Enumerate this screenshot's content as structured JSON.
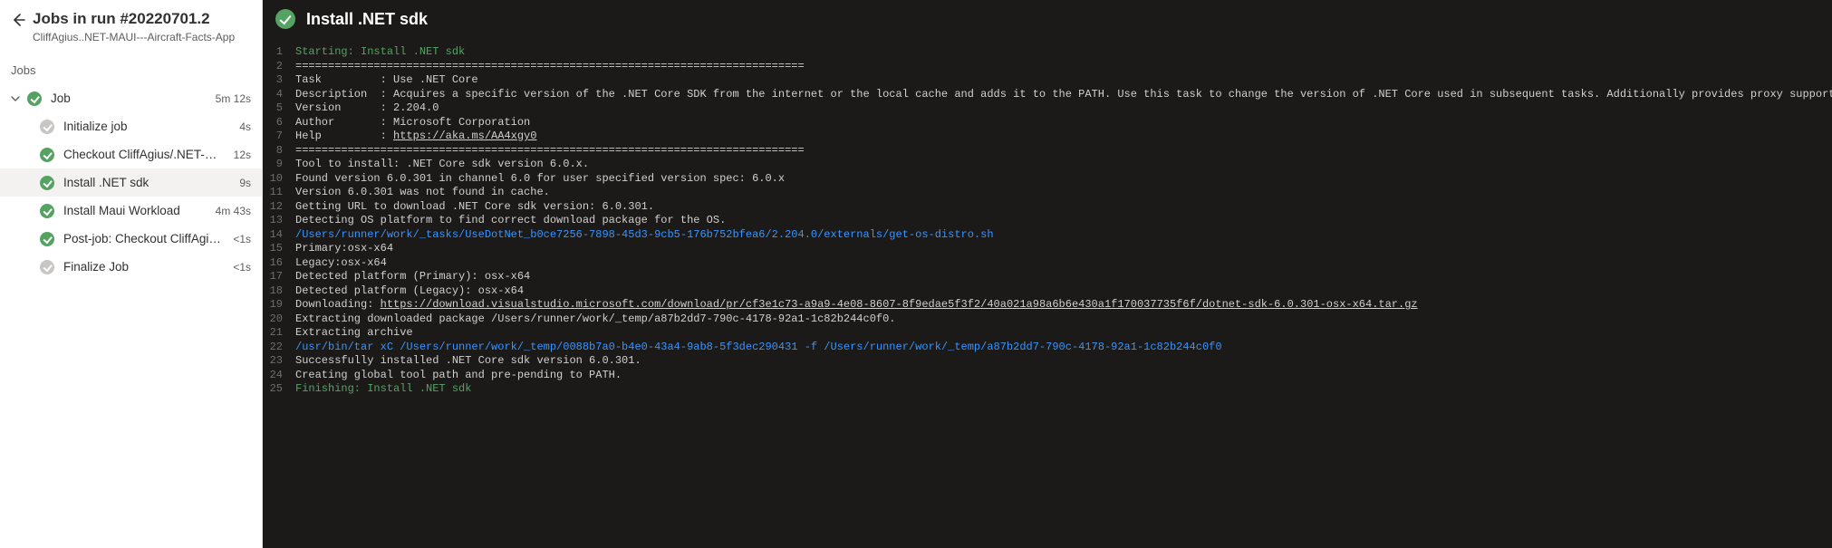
{
  "header": {
    "title": "Jobs in run #20220701.2",
    "subtitle": "CliffAgius..NET-MAUI---Aircraft-Facts-App"
  },
  "section_label": "Jobs",
  "job": {
    "name": "Job",
    "duration": "5m 12s"
  },
  "steps": [
    {
      "icon": "skipped",
      "name": "Initialize job",
      "duration": "4s",
      "selected": false
    },
    {
      "icon": "success",
      "name": "Checkout CliffAgius/.NET-MAUI-...",
      "duration": "12s",
      "selected": false
    },
    {
      "icon": "success",
      "name": "Install .NET sdk",
      "duration": "9s",
      "selected": true
    },
    {
      "icon": "success",
      "name": "Install Maui Workload",
      "duration": "4m 43s",
      "selected": false
    },
    {
      "icon": "success",
      "name": "Post-job: Checkout CliffAgius/.N...",
      "duration": "<1s",
      "selected": false
    },
    {
      "icon": "skipped",
      "name": "Finalize Job",
      "duration": "<1s",
      "selected": false
    }
  ],
  "log": {
    "title": "Install .NET sdk",
    "lines": [
      {
        "n": 1,
        "cls": "c-green",
        "text": "Starting: Install .NET sdk"
      },
      {
        "n": 2,
        "text": "=============================================================================="
      },
      {
        "n": 3,
        "text": "Task         : Use .NET Core"
      },
      {
        "n": 4,
        "text": "Description  : Acquires a specific version of the .NET Core SDK from the internet or the local cache and adds it to the PATH. Use this task to change the version of .NET Core used in subsequent tasks. Additionally provides proxy support."
      },
      {
        "n": 5,
        "text": "Version      : 2.204.0"
      },
      {
        "n": 6,
        "text": "Author       : Microsoft Corporation"
      },
      {
        "n": 7,
        "pre": "Help         : ",
        "link": "https://aka.ms/AA4xgy0"
      },
      {
        "n": 8,
        "text": "=============================================================================="
      },
      {
        "n": 9,
        "text": "Tool to install: .NET Core sdk version 6.0.x."
      },
      {
        "n": 10,
        "text": "Found version 6.0.301 in channel 6.0 for user specified version spec: 6.0.x"
      },
      {
        "n": 11,
        "text": "Version 6.0.301 was not found in cache."
      },
      {
        "n": 12,
        "text": "Getting URL to download .NET Core sdk version: 6.0.301."
      },
      {
        "n": 13,
        "text": "Detecting OS platform to find correct download package for the OS."
      },
      {
        "n": 14,
        "cls": "c-cyan",
        "text": "/Users/runner/work/_tasks/UseDotNet_b0ce7256-7898-45d3-9cb5-176b752bfea6/2.204.0/externals/get-os-distro.sh"
      },
      {
        "n": 15,
        "text": "Primary:osx-x64"
      },
      {
        "n": 16,
        "text": "Legacy:osx-x64"
      },
      {
        "n": 17,
        "text": "Detected platform (Primary): osx-x64"
      },
      {
        "n": 18,
        "text": "Detected platform (Legacy): osx-x64"
      },
      {
        "n": 19,
        "pre": "Downloading: ",
        "link": "https://download.visualstudio.microsoft.com/download/pr/cf3e1c73-a9a9-4e08-8607-8f9edae5f3f2/40a021a98a6b6e430a1f170037735f6f/dotnet-sdk-6.0.301-osx-x64.tar.gz"
      },
      {
        "n": 20,
        "text": "Extracting downloaded package /Users/runner/work/_temp/a87b2dd7-790c-4178-92a1-1c82b244c0f0."
      },
      {
        "n": 21,
        "text": "Extracting archive"
      },
      {
        "n": 22,
        "cls": "c-cyan",
        "text": "/usr/bin/tar xC /Users/runner/work/_temp/0088b7a0-b4e0-43a4-9ab8-5f3dec290431 -f /Users/runner/work/_temp/a87b2dd7-790c-4178-92a1-1c82b244c0f0"
      },
      {
        "n": 23,
        "text": "Successfully installed .NET Core sdk version 6.0.301."
      },
      {
        "n": 24,
        "text": "Creating global tool path and pre-pending to PATH."
      },
      {
        "n": 25,
        "cls": "c-green",
        "text": "Finishing: Install .NET sdk"
      }
    ]
  }
}
